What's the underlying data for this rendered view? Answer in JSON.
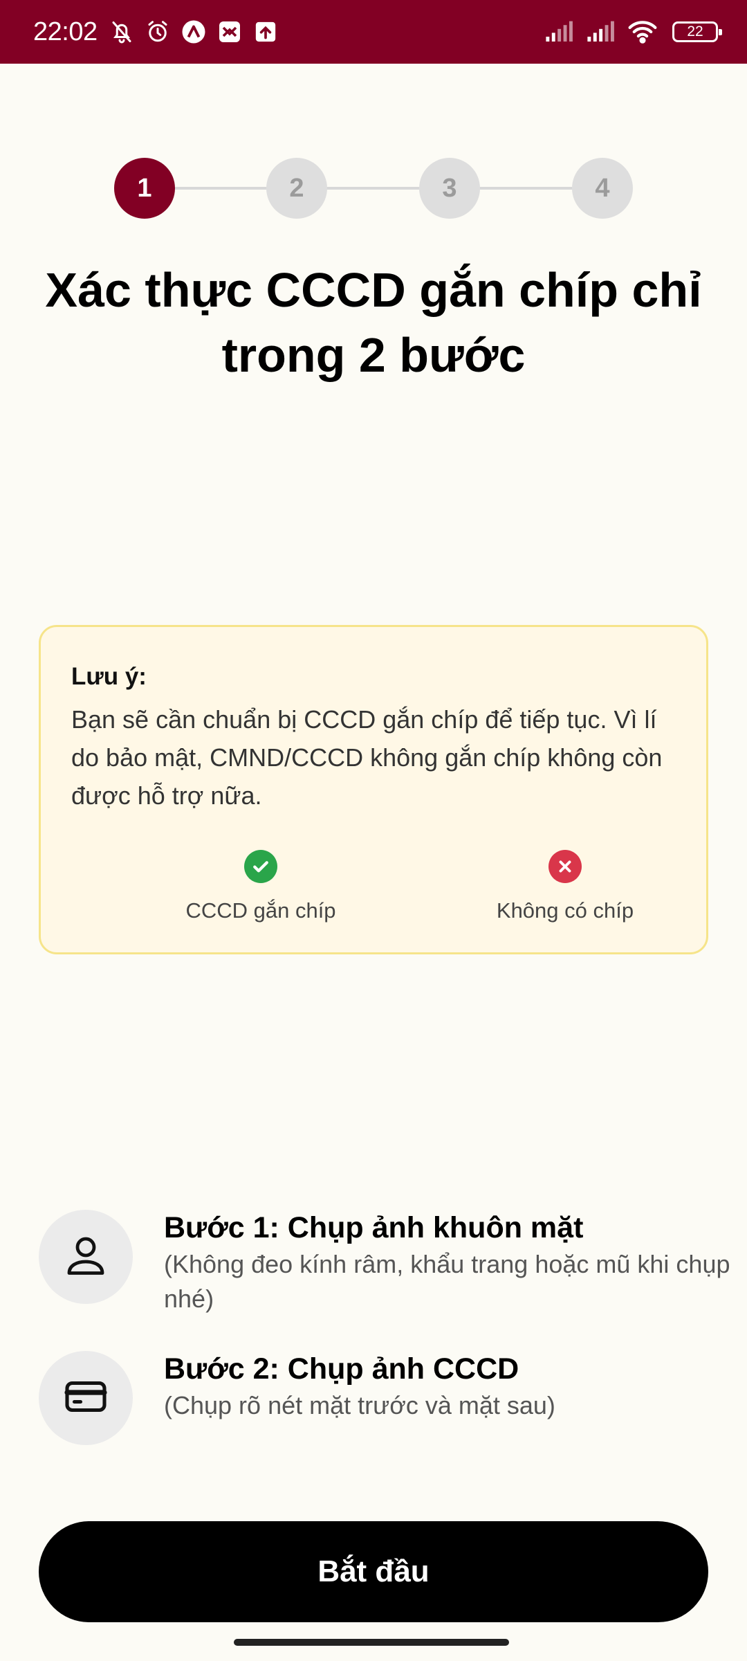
{
  "status_bar": {
    "time": "22:02",
    "battery": "22",
    "icons": [
      "bell-off-icon",
      "alarm-icon",
      "app-a-icon",
      "app-b-icon",
      "upload-icon",
      "signal-icon",
      "signal-icon",
      "wifi-icon",
      "battery-icon"
    ]
  },
  "stepper": {
    "steps": [
      "1",
      "2",
      "3",
      "4"
    ],
    "active_step": 1
  },
  "title": "Xác thực CCCD gắn chíp chỉ trong 2 bước",
  "note": {
    "title": "Lưu ý:",
    "body": "Bạn sẽ cần chuẩn bị CCCD gắn chíp để tiếp tục. Vì lí do bảo mật, CMND/CCCD không gắn chíp không còn được hỗ trợ nữa.",
    "options": [
      {
        "label": "CCCD gắn chíp",
        "icon": "check-circle-icon",
        "color": "#2aa54a"
      },
      {
        "label": "Không có chíp",
        "icon": "x-circle-icon",
        "color": "#d9364a"
      }
    ]
  },
  "steps": [
    {
      "title": "Bước 1: Chụp ảnh khuôn mặt",
      "desc": "(Không đeo kính râm, khẩu trang hoặc mũ khi chụp nhé)",
      "icon": "person-icon"
    },
    {
      "title": "Bước 2: Chụp ảnh CCCD",
      "desc": "(Chụp rõ nét mặt trước và mặt sau)",
      "icon": "id-card-icon"
    }
  ],
  "start_button": "Bắt đầu",
  "colors": {
    "brand": "#820024",
    "background": "#fcfbf5",
    "note_bg": "#fff8e6",
    "note_border": "#f6e48a"
  }
}
